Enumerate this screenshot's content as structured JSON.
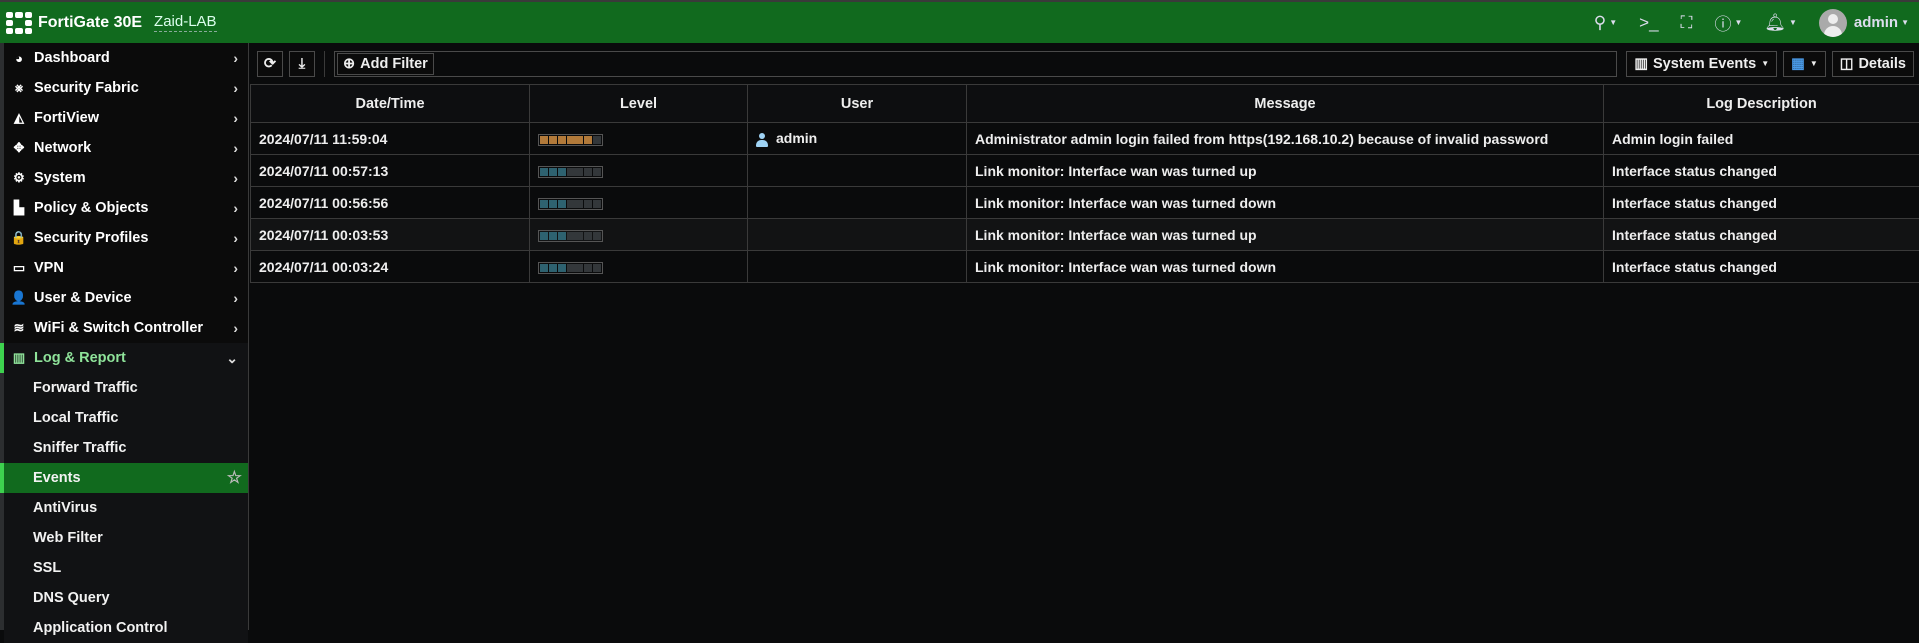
{
  "header": {
    "brand": "FortiGate 30E",
    "hostname": "Zaid-LAB",
    "user": "admin",
    "icons": [
      "search-icon",
      "cli-console-icon",
      "fullscreen-icon",
      "help-icon",
      "bell-icon"
    ]
  },
  "sidebar": {
    "items": [
      {
        "label": "Dashboard",
        "icon": "dashboard-icon",
        "glyph": "◕"
      },
      {
        "label": "Security Fabric",
        "icon": "security-fabric-icon",
        "glyph": "⨳"
      },
      {
        "label": "FortiView",
        "icon": "fortiview-icon",
        "glyph": "◭"
      },
      {
        "label": "Network",
        "icon": "network-icon",
        "glyph": "✥"
      },
      {
        "label": "System",
        "icon": "gear-icon",
        "glyph": "⚙"
      },
      {
        "label": "Policy & Objects",
        "icon": "policy-icon",
        "glyph": "▙"
      },
      {
        "label": "Security Profiles",
        "icon": "lock-icon",
        "glyph": "🔒"
      },
      {
        "label": "VPN",
        "icon": "laptop-icon",
        "glyph": "▭"
      },
      {
        "label": "User & Device",
        "icon": "user-icon",
        "glyph": "👤"
      },
      {
        "label": "WiFi & Switch Controller",
        "icon": "wifi-icon",
        "glyph": "≋"
      },
      {
        "label": "Log & Report",
        "icon": "bar-chart-icon",
        "glyph": "▥"
      }
    ],
    "subitems": [
      "Forward Traffic",
      "Local Traffic",
      "Sniffer Traffic",
      "Events",
      "AntiVirus",
      "Web Filter",
      "SSL",
      "DNS Query",
      "Application Control"
    ],
    "active": "Events"
  },
  "toolbar": {
    "add_filter": "Add Filter",
    "event_type": "System Events",
    "details": "Details"
  },
  "table": {
    "columns": [
      "Date/Time",
      "Level",
      "User",
      "Message",
      "Log Description"
    ],
    "rows": [
      {
        "datetime": "2024/07/11 11:59:04",
        "level": 5,
        "level_color": "#b27a3a",
        "user": "admin",
        "message": "Administrator admin login failed from https(192.168.10.2) because of invalid password",
        "description": "Admin login failed"
      },
      {
        "datetime": "2024/07/11 00:57:13",
        "level": 3,
        "level_color": "#2e6270",
        "user": "",
        "message": "Link monitor: Interface wan was turned up",
        "description": "Interface status changed"
      },
      {
        "datetime": "2024/07/11 00:56:56",
        "level": 3,
        "level_color": "#2e6270",
        "user": "",
        "message": "Link monitor: Interface wan was turned down",
        "description": "Interface status changed"
      },
      {
        "datetime": "2024/07/11 00:03:53",
        "level": 3,
        "level_color": "#2e6270",
        "user": "",
        "message": "Link monitor: Interface wan was turned up",
        "description": "Interface status changed"
      },
      {
        "datetime": "2024/07/11 00:03:24",
        "level": 3,
        "level_color": "#2e6270",
        "user": "",
        "message": "Link monitor: Interface wan was turned down",
        "description": "Interface status changed"
      }
    ]
  }
}
